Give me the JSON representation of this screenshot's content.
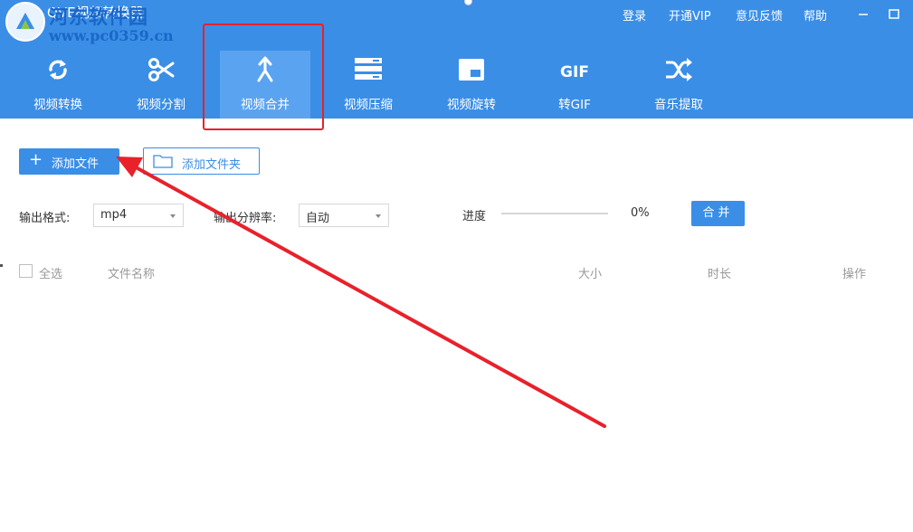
{
  "app": {
    "title": "QVE视频转换器",
    "watermark_name": "河东软件园",
    "watermark_url": "www.pc0359.cn"
  },
  "title_bar": {
    "links": [
      "登录",
      "开通VIP",
      "意见反馈",
      "帮助"
    ]
  },
  "toolbar": {
    "items": [
      {
        "label": "视频转换",
        "icon": "convert-icon"
      },
      {
        "label": "视频分割",
        "icon": "scissors-icon"
      },
      {
        "label": "视频合并",
        "icon": "merge-icon"
      },
      {
        "label": "视频压缩",
        "icon": "compress-icon"
      },
      {
        "label": "视频旋转",
        "icon": "rotate-icon"
      },
      {
        "label": "转GIF",
        "icon": "gif-icon",
        "icon_text": "GIF"
      },
      {
        "label": "音乐提取",
        "icon": "shuffle-icon"
      }
    ],
    "active_index": 2
  },
  "actions": {
    "add_file": "添加文件",
    "add_folder": "添加文件夹"
  },
  "options": {
    "format_label": "输出格式:",
    "format_value": "mp4",
    "resolution_label": "输出分辨率:",
    "resolution_value": "自动",
    "progress_label": "进度",
    "progress_value": 0,
    "progress_text": "0%",
    "merge_button": "合并"
  },
  "table": {
    "select_all": "全选",
    "columns": [
      "文件名称",
      "大小",
      "时长",
      "操作"
    ]
  },
  "colors": {
    "header": "#3a8ee6",
    "active_tab": "#5aa3f0",
    "annotation": "#e8212b"
  }
}
